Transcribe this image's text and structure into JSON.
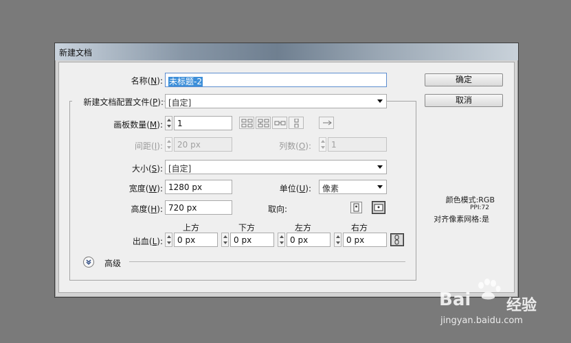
{
  "dialog": {
    "title": "新建文档"
  },
  "form": {
    "name": {
      "label_pre": "名称(",
      "key": "N",
      "label_post": "):",
      "value": "未标题-2"
    },
    "profile": {
      "label_pre": "新建文档配置文件(",
      "key": "P",
      "label_post": "):",
      "value": "[自定]"
    },
    "artboards": {
      "label_pre": "画板数量(",
      "key": "M",
      "label_post": "):",
      "value": "1"
    },
    "spacing": {
      "label_pre": "间距(",
      "key": "I",
      "label_post": "):",
      "value": "20 px"
    },
    "columns": {
      "label_pre": "列数(",
      "key": "O",
      "label_post": "):",
      "value": "1"
    },
    "size": {
      "label_pre": "大小(",
      "key": "S",
      "label_post": "):",
      "value": "[自定]"
    },
    "width": {
      "label_pre": "宽度(",
      "key": "W",
      "label_post": "):",
      "value": "1280 px"
    },
    "units": {
      "label_pre": "单位(",
      "key": "U",
      "label_post": "):",
      "value": "像素"
    },
    "height": {
      "label_pre": "高度(",
      "key": "H",
      "label_post": "):",
      "value": "720 px"
    },
    "orientation": {
      "label": "取向:"
    },
    "bleed": {
      "label_pre": "出血(",
      "key": "L",
      "label_post": "):",
      "top": {
        "label": "上方",
        "value": "0 px"
      },
      "bottom": {
        "label": "下方",
        "value": "0 px"
      },
      "left": {
        "label": "左方",
        "value": "0 px"
      },
      "right": {
        "label": "右方",
        "value": "0 px"
      }
    },
    "advanced": {
      "label": "高级"
    }
  },
  "buttons": {
    "ok": "确定",
    "cancel": "取消"
  },
  "info": {
    "color_mode": "颜色模式:RGB",
    "ppi": "PPI:72",
    "pixel_grid": "对齐像素网格:是"
  },
  "watermark": {
    "brand": "Bai",
    "brand2": "经验",
    "url": "jingyan.baidu.com"
  },
  "icons": [
    "grid-by-row-icon",
    "grid-by-column-icon",
    "arrange-by-row-icon",
    "arrange-by-column-icon",
    "left-to-right-icon",
    "portrait-icon",
    "landscape-icon",
    "link-bleed-icon",
    "expand-chevron-icon"
  ]
}
